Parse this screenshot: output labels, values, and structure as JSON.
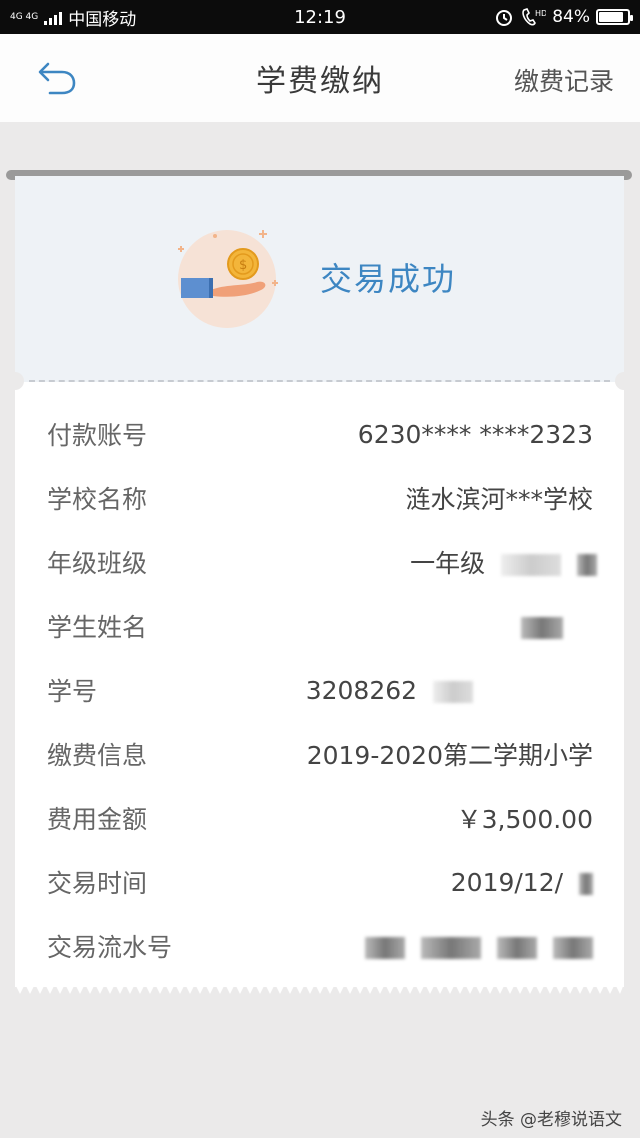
{
  "status_bar": {
    "network": "4G 4G",
    "carrier": "中国移动",
    "time": "12:19",
    "battery": "84%",
    "battery_level": 0.84
  },
  "header": {
    "title": "学费缴纳",
    "right_link": "缴费记录"
  },
  "result": {
    "status_text": "交易成功"
  },
  "details": {
    "rows": [
      {
        "label": "付款账号",
        "value": "6230**** ****2323"
      },
      {
        "label": "学校名称",
        "value": "涟水滨河***学校"
      },
      {
        "label": "年级班级",
        "value": "一年级"
      },
      {
        "label": "学生姓名",
        "value": ""
      },
      {
        "label": "学号",
        "value": "3208262"
      },
      {
        "label": "缴费信息",
        "value": "2019-2020第二学期小学"
      },
      {
        "label": "费用金额",
        "value": "￥3,500.00"
      },
      {
        "label": "交易时间",
        "value": "2019/12/"
      },
      {
        "label": "交易流水号",
        "value": ""
      }
    ]
  },
  "watermark": "头条 @老穆说语文",
  "colors": {
    "accent": "#3d86c2",
    "page_bg": "#ebeaea",
    "receipt_top": "#eef2f6"
  }
}
